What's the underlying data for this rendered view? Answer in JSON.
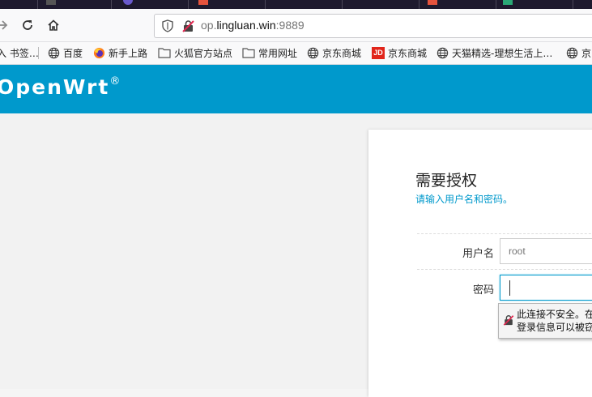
{
  "browser": {
    "url_prefix": "op.",
    "url_host": "lingluan.win",
    "url_suffix": ":9889"
  },
  "bookmarks": [
    {
      "label": "入 书签…",
      "icon": "none"
    },
    {
      "label": "百度",
      "icon": "globe-icon"
    },
    {
      "label": "新手上路",
      "icon": "firefox-icon"
    },
    {
      "label": "火狐官方站点",
      "icon": "folder-icon"
    },
    {
      "label": "常用网址",
      "icon": "folder-icon"
    },
    {
      "label": "京东商城",
      "icon": "globe-icon"
    },
    {
      "label": "京东商城",
      "icon": "jd-icon"
    },
    {
      "label": "天猫精选-理想生活上…",
      "icon": "globe-icon"
    },
    {
      "label": "京",
      "icon": "globe-icon"
    }
  ],
  "jd_badge": "JD",
  "header": {
    "brand": "OpenWrt",
    "registered": "®"
  },
  "login": {
    "title": "需要授权",
    "subtitle": "请输入用户名和密码。",
    "username_label": "用户名",
    "username_placeholder": "root",
    "password_label": "密码"
  },
  "warning": {
    "line1": "此连接不安全。在",
    "line2": "登录信息可以被窃"
  },
  "colors": {
    "accent": "#0099cc",
    "tabstrip": "#1e1a2e"
  }
}
